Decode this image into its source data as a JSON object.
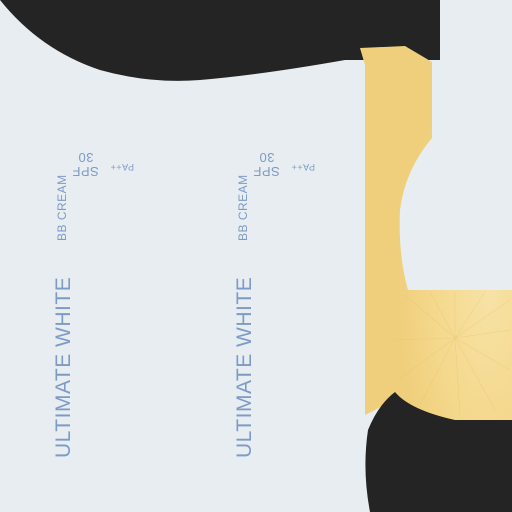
{
  "product": {
    "name": "ULTIMATE  WHITE",
    "type": "BB   CREAM",
    "spf": "SPF",
    "spf_value": "30",
    "pa": "PA++"
  },
  "colors": {
    "background": "#e8edf2",
    "text": "#7d9bc4",
    "cap": "#242424",
    "cream": "#f4d88c"
  }
}
